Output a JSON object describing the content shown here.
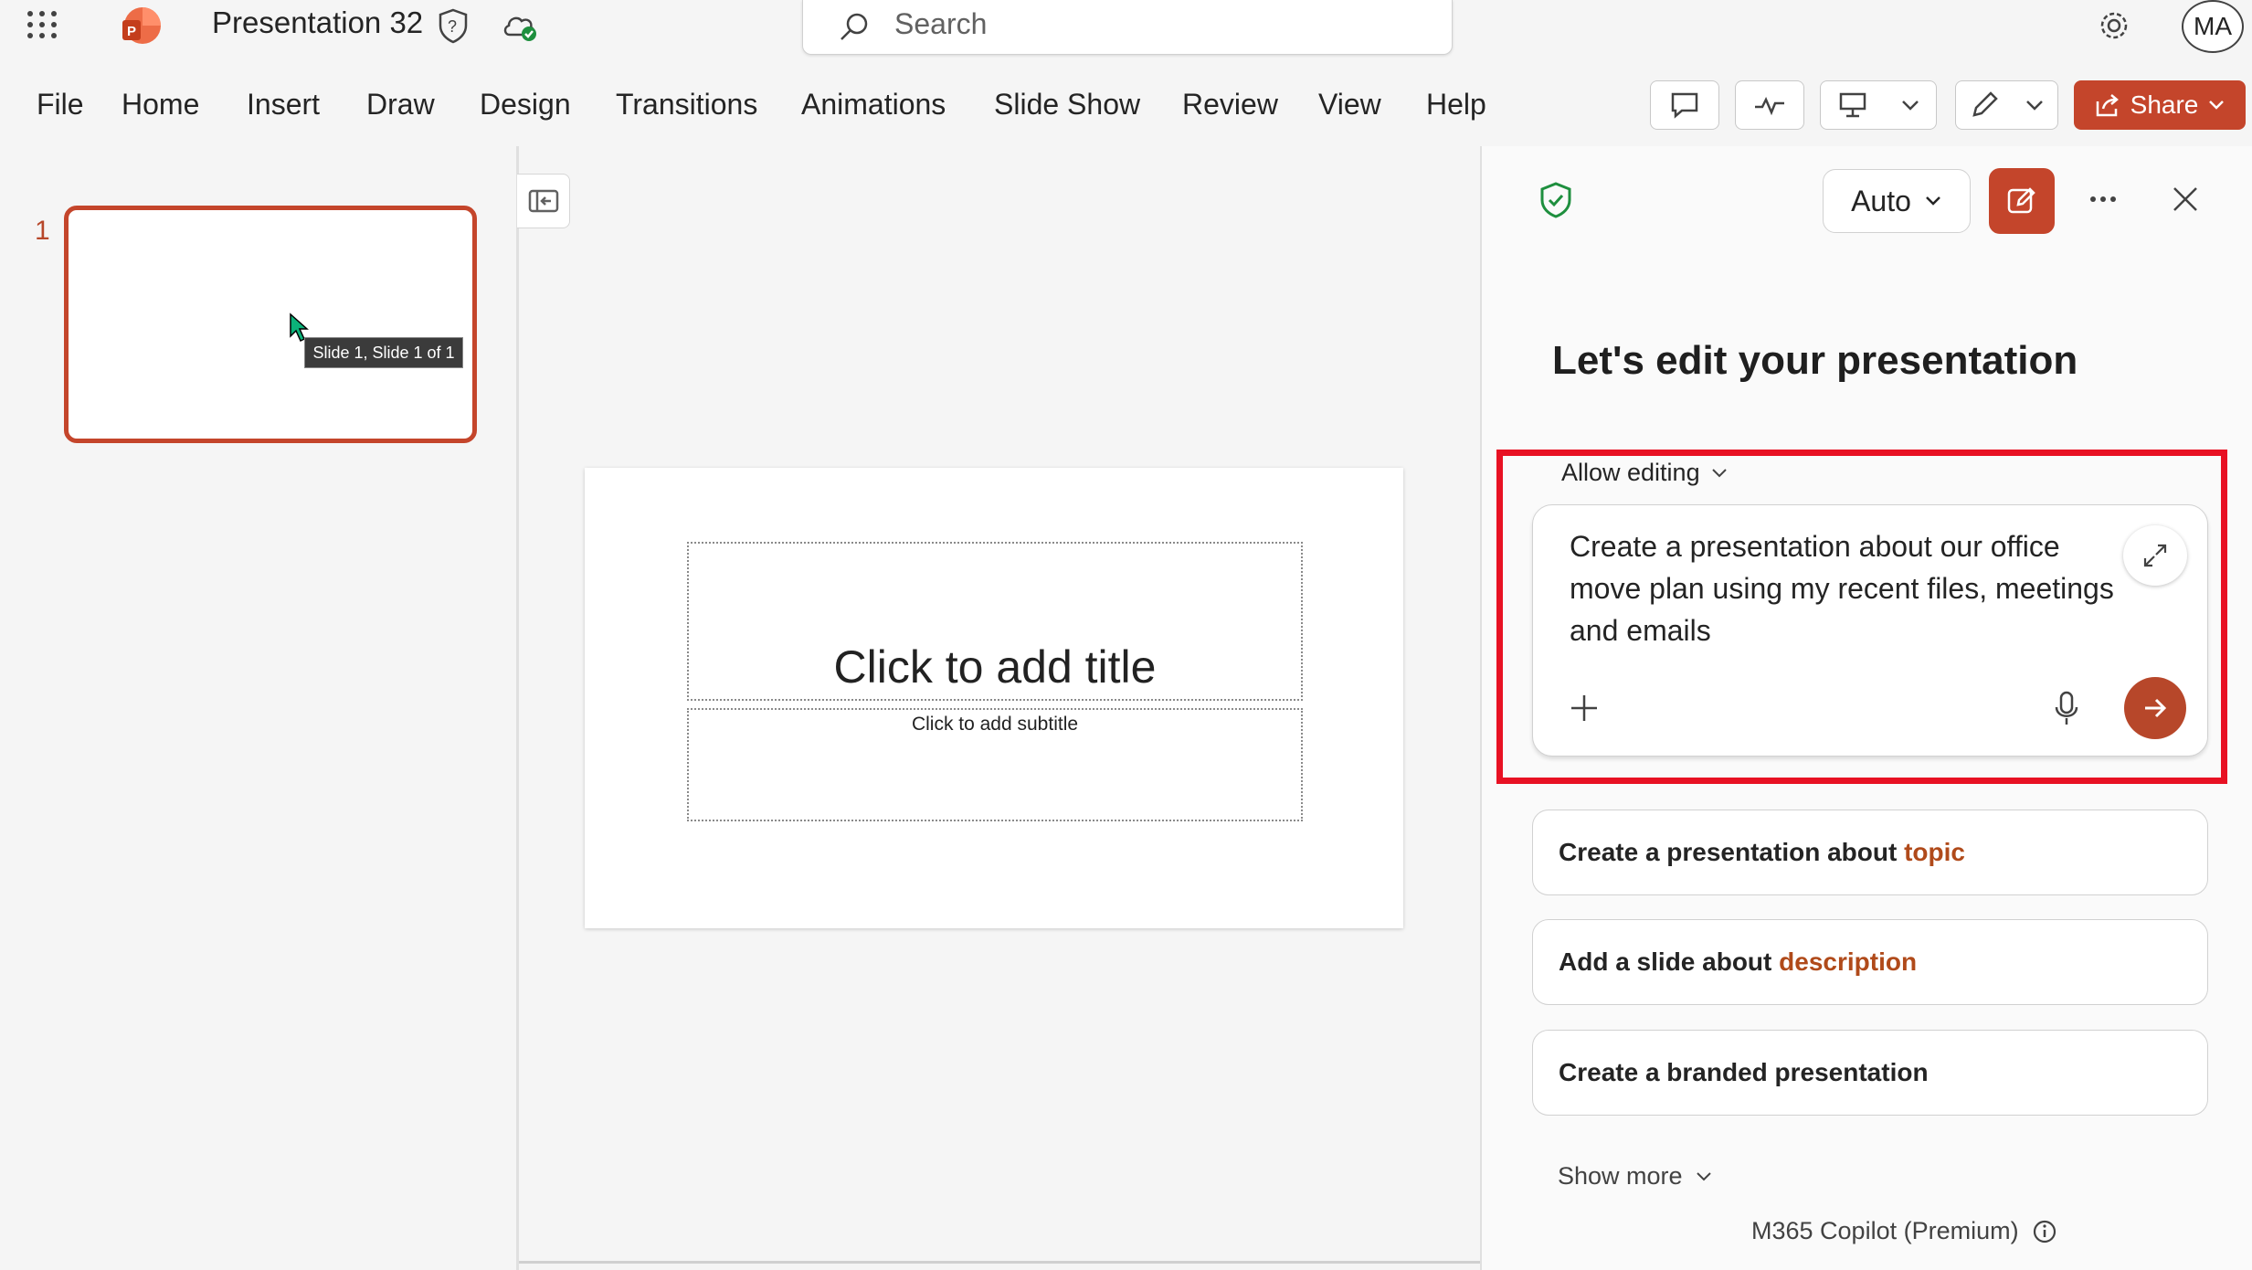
{
  "app": {
    "doc_title": "Presentation 32",
    "search_placeholder": "Search",
    "avatar_initials": "MA",
    "accent_color": "#c4452b"
  },
  "menu": [
    "File",
    "Home",
    "Insert",
    "Draw",
    "Design",
    "Transitions",
    "Animations",
    "Slide Show",
    "Review",
    "View",
    "Help"
  ],
  "toolbar": {
    "share_label": "Share"
  },
  "thumbnails": {
    "slide_number": "1",
    "tooltip": "Slide 1, Slide 1 of 1"
  },
  "slide": {
    "title_placeholder": "Click to add title",
    "subtitle_placeholder": "Click to add subtitle"
  },
  "copilot": {
    "mode_label": "Auto",
    "heading": "Let's edit your presentation",
    "allow_label": "Allow editing",
    "prompt_text": "Create a presentation about our office move plan using my recent files, meetings and emails",
    "suggestions": [
      {
        "text": "Create a presentation about ",
        "accent": "topic"
      },
      {
        "text": "Add a slide about ",
        "accent": "description"
      },
      {
        "text": "Create a branded presentation",
        "accent": ""
      }
    ],
    "show_more": "Show more",
    "footer": "M365 Copilot (Premium)"
  }
}
